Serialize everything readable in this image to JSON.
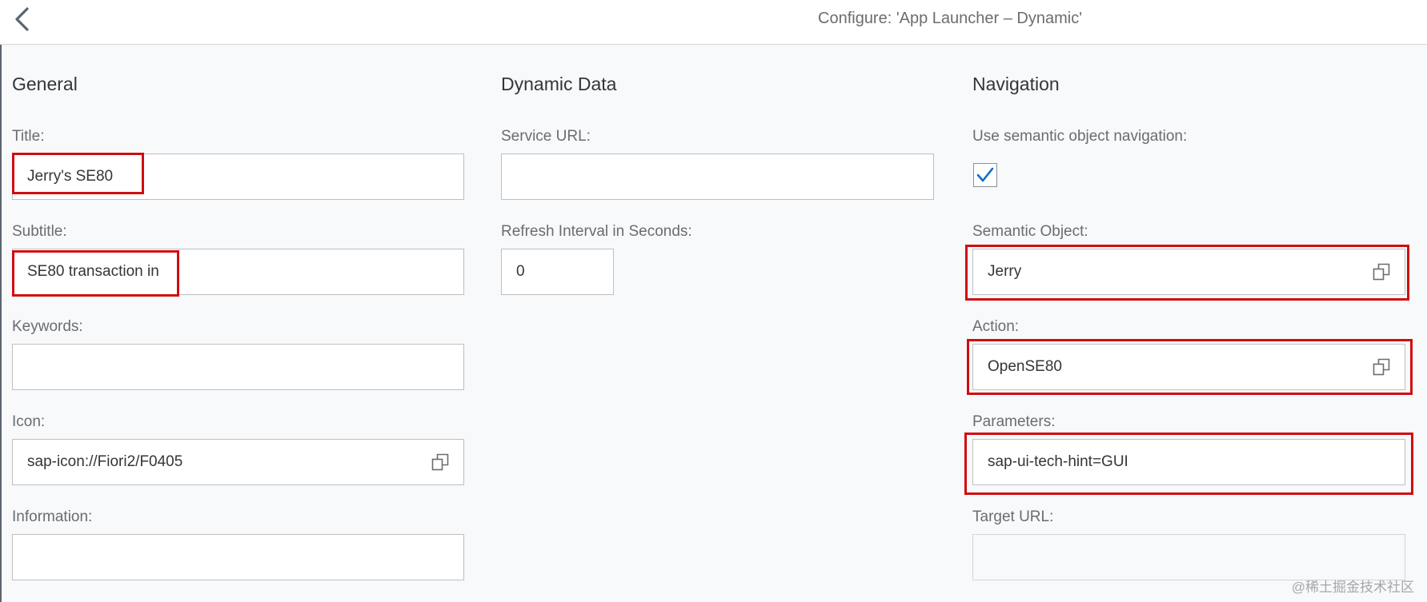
{
  "header": {
    "title": "Configure: 'App Launcher – Dynamic'"
  },
  "general": {
    "heading": "General",
    "title_label": "Title:",
    "title_value": "Jerry's SE80",
    "subtitle_label": "Subtitle:",
    "subtitle_value": "SE80 transaction in",
    "keywords_label": "Keywords:",
    "keywords_value": "",
    "icon_label": "Icon:",
    "icon_value": "sap-icon://Fiori2/F0405",
    "information_label": "Information:",
    "information_value": ""
  },
  "dynamic": {
    "heading": "Dynamic Data",
    "service_url_label": "Service URL:",
    "service_url_value": "",
    "refresh_label": "Refresh Interval in Seconds:",
    "refresh_value": "0"
  },
  "navigation": {
    "heading": "Navigation",
    "semantic_nav_label": "Use semantic object navigation:",
    "semantic_nav_checked": true,
    "semantic_object_label": "Semantic Object:",
    "semantic_object_value": "Jerry",
    "action_label": "Action:",
    "action_value": "OpenSE80",
    "parameters_label": "Parameters:",
    "parameters_value": "sap-ui-tech-hint=GUI",
    "target_url_label": "Target URL:",
    "target_url_value": ""
  },
  "icons": {
    "back": "chevron-left-icon",
    "value_help": "value-help-icon",
    "check": "checkmark-icon"
  },
  "colors": {
    "highlight": "#d10c10",
    "checkmark": "#0a6ed1"
  },
  "watermark": "@稀土掘金技术社区"
}
